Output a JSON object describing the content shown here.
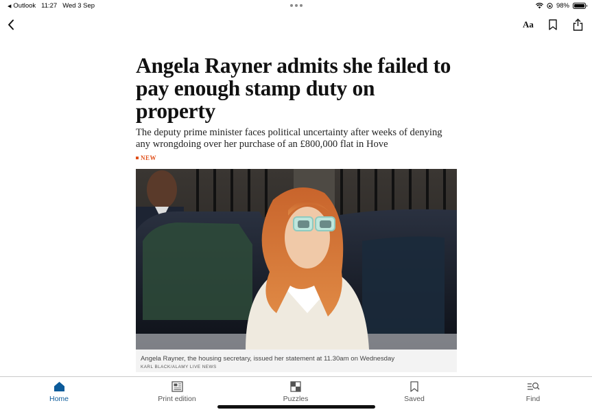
{
  "status_bar": {
    "back_app": "Outlook",
    "time": "11:27",
    "date": "Wed 3 Sep",
    "battery_percent": "98%",
    "battery_level": 0.98
  },
  "nav": {
    "font_size_label": "Aa"
  },
  "article": {
    "headline": "Angela Rayner admits she failed to pay enough stamp duty on property",
    "standfirst": "The deputy prime minister faces political uncertainty after weeks of denying any wrongdoing over her purchase of an £800,000 flat in Hove",
    "badge": "NEW",
    "caption": "Angela Rayner, the housing secretary, issued her statement at 11.30am on Wednesday",
    "credit": "KARL BLACK/ALAMY LIVE NEWS"
  },
  "tabs": [
    {
      "label": "Home",
      "icon": "home-icon",
      "active": true
    },
    {
      "label": "Print edition",
      "icon": "newspaper-icon",
      "active": false
    },
    {
      "label": "Puzzles",
      "icon": "puzzle-grid-icon",
      "active": false
    },
    {
      "label": "Saved",
      "icon": "bookmark-icon",
      "active": false
    },
    {
      "label": "Find",
      "icon": "search-list-icon",
      "active": false
    }
  ],
  "colors": {
    "accent_active": "#0c5b9a",
    "badge": "#e0501a"
  }
}
